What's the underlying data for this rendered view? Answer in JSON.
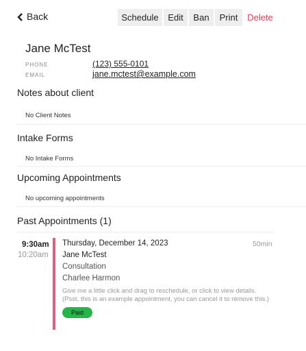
{
  "topbar": {
    "back_label": "Back",
    "buttons": {
      "schedule": "Schedule",
      "edit": "Edit",
      "ban": "Ban",
      "print": "Print",
      "delete": "Delete"
    },
    "delete_color": "#e53950"
  },
  "client": {
    "name": "Jane McTest",
    "phone_label": "PHONE",
    "phone": "(123) 555-0101",
    "email_label": "EMAIL",
    "email": "jane.mctest@example.com"
  },
  "sections": {
    "notes": {
      "title": "Notes about client",
      "empty": "No Client Notes"
    },
    "intake": {
      "title": "Intake Forms",
      "empty": "No Intake Forms"
    },
    "upcoming": {
      "title": "Upcoming Appointments",
      "empty": "No upcoming appointments"
    },
    "past": {
      "title": "Past Appointments (1)"
    }
  },
  "appointment": {
    "start_time": "9:30am",
    "end_time": "10:20am",
    "date": "Thursday, December 14, 2023",
    "duration": "50min",
    "client": "Jane McTest",
    "service": "Consultation",
    "staff": "Charlee Harmon",
    "note": "Give me a little click and drag to reschedule, or click to view details. (Psst, this is an example appointment, you can cancel it to remove this.)",
    "status": "Paid",
    "bar_color": "#e35d81",
    "status_color": "#25b64a"
  }
}
